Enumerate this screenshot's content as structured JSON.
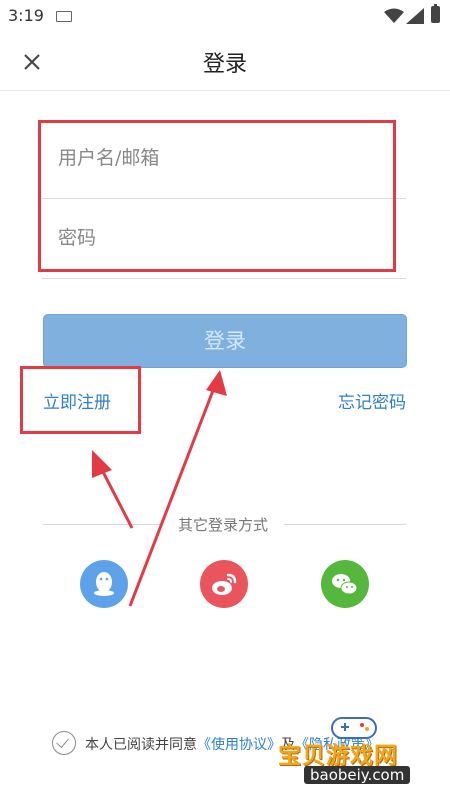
{
  "status_bar": {
    "time": "3:19"
  },
  "header": {
    "title": "登录"
  },
  "form": {
    "username_placeholder": "用户名/邮箱",
    "password_placeholder": "密码",
    "login_label": "登录",
    "register_label": "立即注册",
    "forgot_label": "忘记密码"
  },
  "other_login": {
    "label": "其它登录方式",
    "providers": [
      "qq-icon",
      "weibo-icon",
      "wechat-icon"
    ]
  },
  "agreement": {
    "prefix": "本人已阅读并同意",
    "terms_label": "《使用协议》",
    "conjunction": "及",
    "privacy_label": "《隐私政策》"
  },
  "watermark": {
    "text": "宝贝游戏网",
    "url": "baobeiy.com"
  },
  "colors": {
    "accent": "#2d7fd0",
    "login_button": "#7fb0de",
    "annotation": "#e33b46"
  }
}
